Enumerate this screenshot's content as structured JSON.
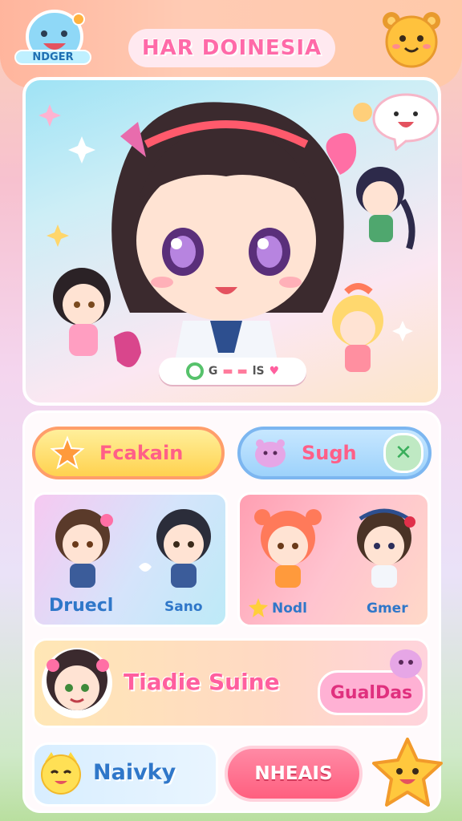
{
  "header": {
    "logo_text": "NDGER",
    "title": "HAR DOINESIA"
  },
  "hero": {
    "status_badge": {
      "left": "G",
      "middle": "▬ ▬",
      "right": "lS"
    }
  },
  "actions": {
    "primary_label": "Fcakain",
    "secondary_label": "Sugh",
    "close_symbol": "✕"
  },
  "cards": [
    {
      "label": "Druecl"
    },
    {
      "label": "Sano"
    },
    {
      "label": "Nodl"
    },
    {
      "label": "Gmer"
    }
  ],
  "profile": {
    "name": "Tiadie Suine",
    "badge": "GualDas"
  },
  "footer": {
    "label": "Naivky",
    "button_label": "NHEAIS"
  },
  "colors": {
    "accent_pink": "#ff5f88",
    "accent_blue": "#2f77c9",
    "accent_yellow": "#ffd24f"
  }
}
